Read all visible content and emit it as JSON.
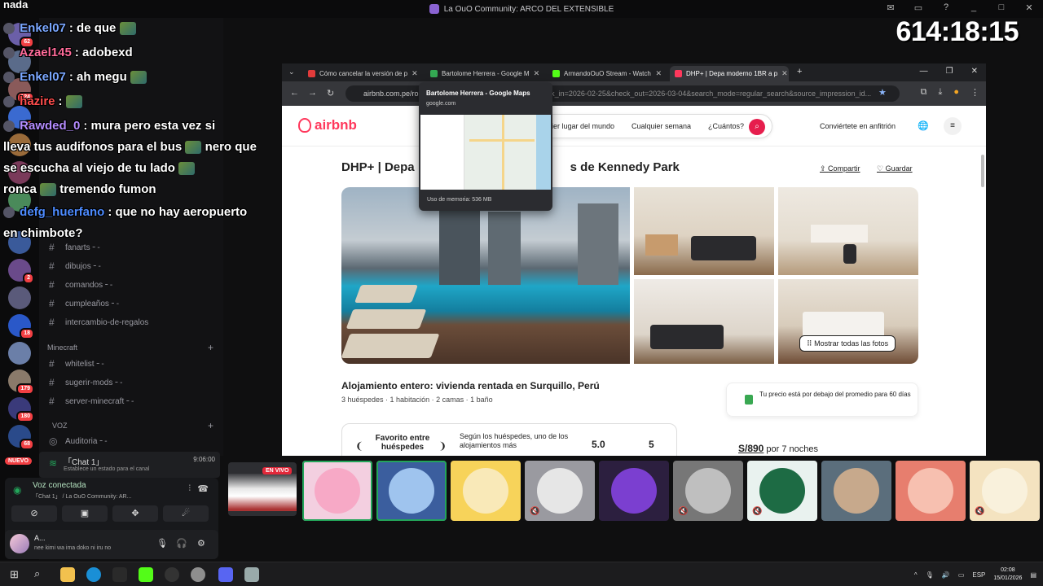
{
  "discord": {
    "window_title": "La OuO Community: ARCO DEL EXTENSIBLE",
    "controls": [
      "_",
      "□",
      "✕"
    ],
    "server_badges": [
      "62",
      "124",
      "5",
      "2",
      "18",
      "179",
      "180",
      "68"
    ],
    "new_badge": "NUEVO",
    "channels": [
      {
        "name": "fanarts╶ -"
      },
      {
        "name": "dibujos╶ -"
      },
      {
        "name": "comandos╶ -"
      },
      {
        "name": "cumpleaños╶ -"
      },
      {
        "name": "intercambio-de-regalos"
      }
    ],
    "category_minecraft": "Minecraft",
    "minecraft_channels": [
      {
        "name": "whitelist╶ -"
      },
      {
        "name": "sugerir-mods╶ -"
      },
      {
        "name": "server-minecraft╶ -"
      }
    ],
    "category_voz": "VOZ",
    "voice_channel": "Auditoria╶ -",
    "current_channel": {
      "name": "「Chat 1」",
      "subtitle": "Establece un estado para el canal",
      "time": "9:06:00"
    },
    "voice": {
      "status": "Voz conectada",
      "location": "「Chat 1」 / La OuO Community: AR...",
      "buttons": [
        "⊘",
        "▣",
        "✥",
        "☄"
      ]
    },
    "user": {
      "name": "A...",
      "status": "nee kimi wa ima doko ni iru no"
    }
  },
  "overlay": {
    "title": "nada",
    "lines": [
      {
        "user": "Enkel07",
        "color": "#7aa7ff",
        "text": ": de que"
      },
      {
        "user": "Azael145",
        "color": "#ff6b9a",
        "text": ": adobexd"
      },
      {
        "user": "Enkel07",
        "color": "#7aa7ff",
        "text": ": ah megu"
      },
      {
        "user": "hazire",
        "color": "#ff4d4d",
        "text": ":"
      },
      {
        "user": "Rawded_0",
        "color": "#b48cff",
        "text": ": mura pero esta vez si"
      },
      {
        "user": "",
        "color": "#fff",
        "text": "lleva tus audifonos para el bus"
      },
      {
        "user": "",
        "color": "#fff",
        "text": "se escucha al viejo de tu lado"
      },
      {
        "user": "",
        "color": "#fff",
        "text": "ronca"
      },
      {
        "user": "defg_huerfano",
        "color": "#4d8bff",
        "text": ": que no hay aeropuerto"
      },
      {
        "user": "",
        "color": "#fff",
        "text": "en chimbote?"
      }
    ],
    "line3_tail": "nero que",
    "line6_tail": "tremendo fumon"
  },
  "timer": "614:18:15",
  "browser": {
    "tabs": [
      {
        "label": "Cómo cancelar la versión de p",
        "color": "#e23b3b"
      },
      {
        "label": "Bartolome Herrera - Google M",
        "color": "#34a853"
      },
      {
        "label": "ArmandoOuO Stream - Watch",
        "color": "#53fc18"
      },
      {
        "label": "DHP+ | Depa moderno 1BR a p",
        "color": "#ff385c"
      }
    ],
    "url": "airbnb.com.pe/ro",
    "url_tail": "eck_in=2026-02-25&check_out=2026-03-04&search_mode=regular_search&source_impression_id...",
    "preview": {
      "title": "Bartolome Herrera - Google Maps",
      "domain": "google.com",
      "memory": "Uso de memoria: 536 MB"
    }
  },
  "airbnb": {
    "logo": "airbnb",
    "search": [
      "ier lugar del mundo",
      "Cualquier semana",
      "¿Cuántos?"
    ],
    "host": "Conviértete en anfitrión",
    "title_start": "DHP+ | Depa",
    "title_end": "s de Kennedy Park",
    "share": "Compartir",
    "save": "Guardar",
    "show_all": "Mostrar todas las fotos",
    "subtitle": "Alojamiento entero: vivienda rentada en Surquillo, Perú",
    "meta": "3 huéspedes · 1 habitación · 2 camas · 1 baño",
    "price_note": "Tu precio está por debajo del promedio para 60 días",
    "favorite": "Favorito entre huéspedes",
    "favorite_desc": "Según los huéspedes, uno de los alojamientos más",
    "rating": "5.0",
    "reviews": "5",
    "price": "S/890",
    "price_suffix": "por 7 noches"
  },
  "strip": {
    "live": "EN VIVO",
    "tiles": [
      {
        "bg": "#f3cfe0",
        "face": "#f7a9c6",
        "speaking": true,
        "muted": false
      },
      {
        "bg": "#3b5e9e",
        "face": "#9fc4ee",
        "speaking": true,
        "muted": false
      },
      {
        "bg": "#f7d35a",
        "face": "#f9e9b8",
        "speaking": false,
        "muted": false
      },
      {
        "bg": "#9a9aa0",
        "face": "#e6e6e6",
        "speaking": false,
        "muted": true
      },
      {
        "bg": "#2c1f3f",
        "face": "#7b3fd0",
        "speaking": false,
        "muted": false
      },
      {
        "bg": "#777",
        "face": "#bfbfbf",
        "speaking": false,
        "muted": true
      },
      {
        "bg": "#e9f2ef",
        "face": "#1d6b44",
        "speaking": false,
        "muted": true
      },
      {
        "bg": "#5b6e7c",
        "face": "#c7a98c",
        "speaking": false,
        "muted": false
      },
      {
        "bg": "#e77e6e",
        "face": "#f7c0b0",
        "speaking": false,
        "muted": false
      },
      {
        "bg": "#f4e3c0",
        "face": "#f9f1dc",
        "speaking": false,
        "muted": true
      }
    ]
  },
  "taskbar": {
    "lang": "ESP",
    "time": "02:08",
    "date": "15/01/2026"
  }
}
